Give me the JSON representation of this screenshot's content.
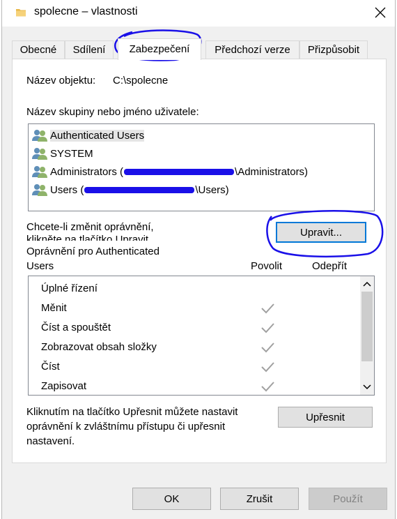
{
  "window": {
    "title": "spolecne – vlastnosti"
  },
  "tabs": [
    {
      "label": "Obecné"
    },
    {
      "label": "Sdílení"
    },
    {
      "label": "Zabezpečení",
      "active": true
    },
    {
      "label": "Předchozí verze"
    },
    {
      "label": "Přizpůsobit"
    }
  ],
  "object": {
    "label": "Název objektu:",
    "value": "C:\\spolecne"
  },
  "groups": {
    "label": "Název skupiny nebo jméno uživatele:",
    "items": [
      {
        "name": "Authenticated Users",
        "suffix": "",
        "selected": true
      },
      {
        "name": "SYSTEM",
        "suffix": ""
      },
      {
        "name": "Administrators (",
        "suffix": "\\Administrators)"
      },
      {
        "name": "Users (",
        "suffix": "\\Users)"
      }
    ]
  },
  "change": {
    "hint_line1": "Chcete-li změnit oprávnění,",
    "hint_line2": "klikněte na tlačítko Upravit.",
    "edit_button": "Upravit..."
  },
  "permissions": {
    "title_line1": "Oprávnění pro Authenticated",
    "title_line2": "Users",
    "col_allow": "Povolit",
    "col_deny": "Odepřít",
    "rows": [
      {
        "name": "Úplné řízení",
        "allow": false
      },
      {
        "name": "Měnit",
        "allow": true
      },
      {
        "name": "Číst a spouštět",
        "allow": true
      },
      {
        "name": "Zobrazovat obsah složky",
        "allow": true
      },
      {
        "name": "Číst",
        "allow": true
      },
      {
        "name": "Zapisovat",
        "allow": true
      }
    ]
  },
  "advanced": {
    "hint_line1": "Kliknutím na tlačítko Upřesnit můžete nastavit",
    "hint_line2": "oprávnění k zvláštnímu přístupu či upřesnit",
    "hint_line3": "nastavení.",
    "button": "Upřesnit"
  },
  "footer": {
    "ok": "OK",
    "cancel": "Zrušit",
    "apply": "Použít"
  },
  "colors": {
    "annotation": "#1a10e8",
    "check_disabled": "#a0a0a0",
    "focus": "#0078d7"
  },
  "icons": {
    "title": "folder-icon",
    "close": "close-icon",
    "user": "user-group-icon",
    "check": "check-icon"
  }
}
